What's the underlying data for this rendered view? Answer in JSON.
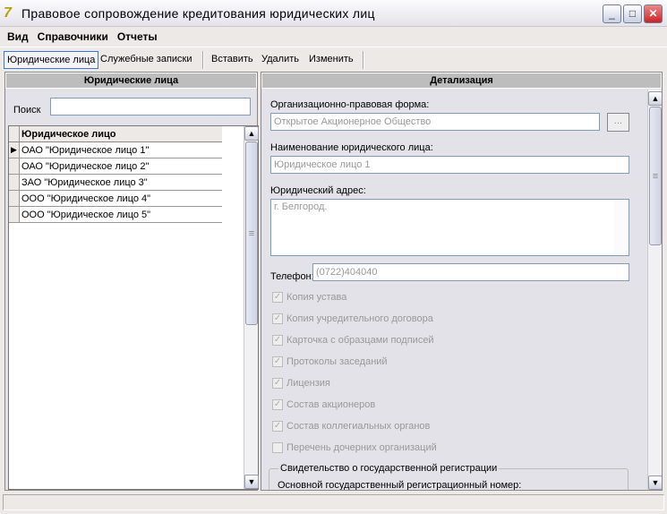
{
  "window": {
    "title": "Правовое сопровождение кредитования юридических лиц"
  },
  "menu": [
    "Вид",
    "Справочники",
    "Отчеты"
  ],
  "toolbar": {
    "tabs": [
      "Юридические лица",
      "Служебные записки"
    ],
    "actions": [
      "Вставить",
      "Удалить",
      "Изменить"
    ]
  },
  "left": {
    "header": "Юридические лица",
    "search_label": "Поиск",
    "search_value": "",
    "column": "Юридическое лицо",
    "rows": [
      "ОАО \"Юридическое лицо 1\"",
      "ОАО \"Юридическое лицо 2\"",
      "ЗАО \"Юридическое лицо 3\"",
      "ООО \"Юридическое лицо 4\"",
      "ООО \"Юридическое лицо 5\""
    ]
  },
  "right": {
    "header": "Детализация",
    "org_form_label": "Организационно-правовая форма:",
    "org_form_value": "Открытое Акционерное Общество",
    "browse": "...",
    "name_label": "Наименование юридического лица:",
    "name_value": "Юридическое лицо 1",
    "address_label": "Юридический адрес:",
    "address_value": "г. Белгород.",
    "phone_label": "Телефон:",
    "phone_value": "(0722)404040",
    "checkboxes": [
      {
        "label": "Копия устава",
        "checked": true
      },
      {
        "label": "Копия учредительного договора",
        "checked": true
      },
      {
        "label": "Карточка с образцами подписей",
        "checked": true
      },
      {
        "label": "Протоколы заседаний",
        "checked": true
      },
      {
        "label": "Лицензия",
        "checked": true
      },
      {
        "label": "Состав акционеров",
        "checked": true
      },
      {
        "label": "Состав коллегиальных органов",
        "checked": true
      },
      {
        "label": "Перечень дочерних организаций",
        "checked": false
      }
    ],
    "group_title": "Свидетельство о государственной регистрации",
    "ogrn_label": "Основной государственный регистрационный номер:"
  }
}
